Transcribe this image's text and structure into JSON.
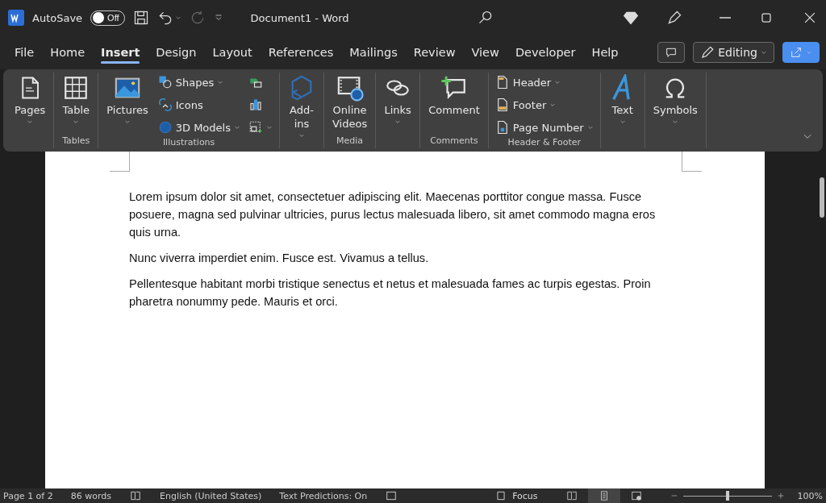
{
  "title_bar": {
    "autosave_label": "AutoSave",
    "autosave": {
      "on": false,
      "text": "Off"
    },
    "document_title": "Document1  -  Word",
    "redo_disabled": true
  },
  "tabs": [
    {
      "label": "File",
      "selected": false
    },
    {
      "label": "Home",
      "selected": false
    },
    {
      "label": "Insert",
      "selected": true
    },
    {
      "label": "Design",
      "selected": false
    },
    {
      "label": "Layout",
      "selected": false
    },
    {
      "label": "References",
      "selected": false
    },
    {
      "label": "Mailings",
      "selected": false
    },
    {
      "label": "Review",
      "selected": false
    },
    {
      "label": "View",
      "selected": false
    },
    {
      "label": "Developer",
      "selected": false
    },
    {
      "label": "Help",
      "selected": false
    }
  ],
  "editing_button": "Editing",
  "ribbon_groups": [
    {
      "items": [
        {
          "kind": "large",
          "label": "Pages",
          "dropdown": true
        }
      ]
    },
    {
      "label": "Tables",
      "items": [
        {
          "kind": "large",
          "label": "Table",
          "dropdown": true
        }
      ]
    },
    {
      "label": "Illustrations",
      "items": [
        {
          "kind": "large",
          "label": "Pictures",
          "dropdown": true
        },
        {
          "kind": "small",
          "label": "Shapes",
          "dropdown": true
        },
        {
          "kind": "small",
          "label": "Icons",
          "dropdown": false
        },
        {
          "kind": "small",
          "label": "3D Models",
          "dropdown": true
        },
        {
          "kind": "icon",
          "dropdown": false
        },
        {
          "kind": "icon",
          "dropdown": false
        },
        {
          "kind": "icon",
          "dropdown": true
        }
      ]
    },
    {
      "items": [
        {
          "kind": "large",
          "label": "Add-\nins",
          "dropdown": true
        }
      ]
    },
    {
      "label": "Media",
      "items": [
        {
          "kind": "large",
          "label": "Online\nVideos",
          "dropdown": false
        }
      ]
    },
    {
      "items": [
        {
          "kind": "large",
          "label": "Links",
          "dropdown": true
        }
      ]
    },
    {
      "label": "Comments",
      "items": [
        {
          "kind": "large",
          "label": "Comment",
          "dropdown": false
        }
      ]
    },
    {
      "label": "Header & Footer",
      "items": [
        {
          "kind": "small",
          "label": "Header",
          "dropdown": true
        },
        {
          "kind": "small",
          "label": "Footer",
          "dropdown": true
        },
        {
          "kind": "small",
          "label": "Page Number",
          "dropdown": true
        }
      ]
    },
    {
      "items": [
        {
          "kind": "large",
          "label": "Text",
          "dropdown": true
        }
      ]
    },
    {
      "items": [
        {
          "kind": "large",
          "label": "Symbols",
          "dropdown": true
        }
      ]
    }
  ],
  "document": {
    "paragraphs": [
      "Lorem ipsum dolor sit amet, consectetuer adipiscing elit. Maecenas porttitor congue massa. Fusce posuere, magna sed pulvinar ultricies, purus lectus malesuada libero, sit amet commodo magna eros quis urna.",
      "Nunc viverra imperdiet enim. Fusce est. Vivamus a tellus.",
      "Pellentesque habitant morbi tristique senectus et netus et malesuada fames ac turpis egestas. Proin pharetra nonummy pede. Mauris et orci."
    ]
  },
  "status_bar": {
    "page": "Page 1 of 2",
    "words": "86 words",
    "language": "English (United States)",
    "predictions": "Text Predictions: On",
    "focus": "Focus",
    "views": [
      {
        "selected": false
      },
      {
        "selected": true
      },
      {
        "selected": false
      }
    ],
    "zoom": {
      "level": 0.5,
      "text": "100%"
    }
  }
}
